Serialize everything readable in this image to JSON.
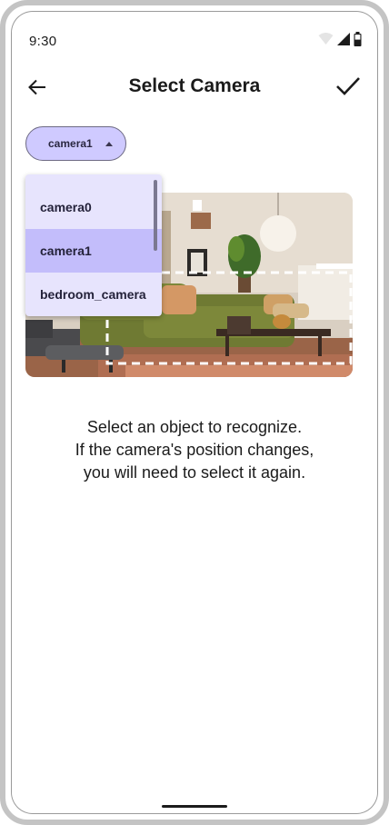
{
  "status_bar": {
    "time": "9:30",
    "icons": [
      "wifi-icon",
      "signal-icon",
      "battery-icon"
    ]
  },
  "app_bar": {
    "title": "Select Camera",
    "back_icon": "arrow-back-icon",
    "confirm_icon": "check-icon"
  },
  "camera_selector": {
    "selected": "camera1",
    "expanded": true,
    "options": [
      {
        "label": "camera0",
        "selected": false
      },
      {
        "label": "camera1",
        "selected": true
      },
      {
        "label": "bedroom_camera",
        "selected": false
      }
    ]
  },
  "preview": {
    "subject": "living room with green sofa",
    "selection_box": "dashed white rectangle"
  },
  "instructions": {
    "line1": "Select an object to recognize.",
    "line2": "If the camera's position changes,",
    "line3": "you will need to select it again."
  },
  "colors": {
    "chip_bg": "#cfcaff",
    "menu_bg": "#e7e4fd",
    "menu_selected": "#c3bdfb",
    "text": "#1b1b1b"
  }
}
